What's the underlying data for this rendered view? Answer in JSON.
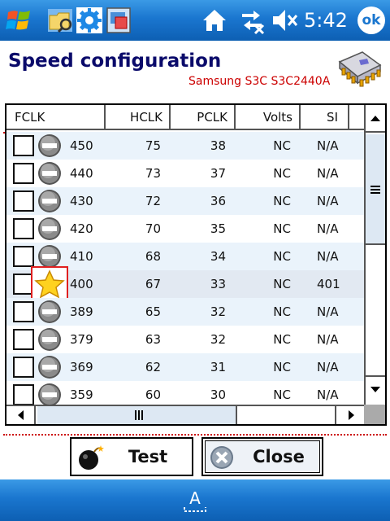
{
  "taskbar": {
    "time": "5:42",
    "ok_label": "ok",
    "icons": [
      "windows-start-icon",
      "file-explorer-icon",
      "settings-gear-icon",
      "application-icon",
      "home-icon",
      "connectivity-icon",
      "volume-muted-icon"
    ]
  },
  "header": {
    "title": "Speed configuration",
    "device": "Samsung S3C S3C2440A",
    "icon": "cpu-chip-icon"
  },
  "table": {
    "columns": [
      "FCLK",
      "HCLK",
      "PCLK",
      "Volts",
      "SI"
    ],
    "rows": [
      {
        "fclk": "450",
        "hclk": "75",
        "pclk": "38",
        "volts": "NC",
        "si": "N/A",
        "icon": "minus-circle-icon"
      },
      {
        "fclk": "440",
        "hclk": "73",
        "pclk": "37",
        "volts": "NC",
        "si": "N/A",
        "icon": "minus-circle-icon"
      },
      {
        "fclk": "430",
        "hclk": "72",
        "pclk": "36",
        "volts": "NC",
        "si": "N/A",
        "icon": "minus-circle-icon"
      },
      {
        "fclk": "420",
        "hclk": "70",
        "pclk": "35",
        "volts": "NC",
        "si": "N/A",
        "icon": "minus-circle-icon"
      },
      {
        "fclk": "410",
        "hclk": "68",
        "pclk": "34",
        "volts": "NC",
        "si": "N/A",
        "icon": "minus-circle-icon"
      },
      {
        "fclk": "400",
        "hclk": "67",
        "pclk": "33",
        "volts": "NC",
        "si": "401",
        "icon": "star-icon",
        "selected": true
      },
      {
        "fclk": "389",
        "hclk": "65",
        "pclk": "32",
        "volts": "NC",
        "si": "N/A",
        "icon": "minus-circle-icon"
      },
      {
        "fclk": "379",
        "hclk": "63",
        "pclk": "32",
        "volts": "NC",
        "si": "N/A",
        "icon": "minus-circle-icon"
      },
      {
        "fclk": "369",
        "hclk": "62",
        "pclk": "31",
        "volts": "NC",
        "si": "N/A",
        "icon": "minus-circle-icon"
      },
      {
        "fclk": "359",
        "hclk": "60",
        "pclk": "30",
        "volts": "NC",
        "si": "N/A",
        "icon": "minus-circle-icon"
      }
    ]
  },
  "buttons": {
    "test_label": "Test",
    "close_label": "Close"
  },
  "softbar": {
    "sip_label": "A"
  },
  "colors": {
    "taskbar": "#1a76cf",
    "title": "#0a0a6a",
    "device": "#cc0000",
    "selection": "#e02020",
    "alt_row": "#eaf3fb"
  }
}
